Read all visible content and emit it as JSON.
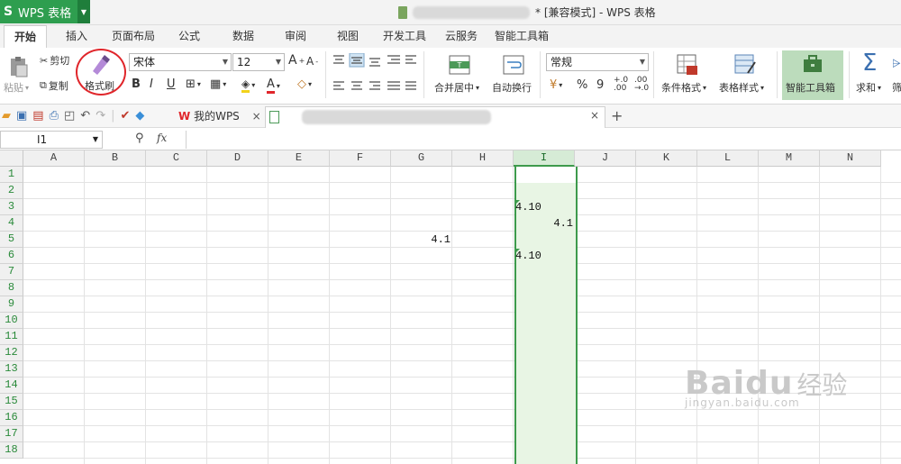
{
  "app": {
    "logo": "S",
    "name": "WPS 表格",
    "window_title": "* [兼容模式] - WPS 表格"
  },
  "tabs": [
    "开始",
    "插入",
    "页面布局",
    "公式",
    "数据",
    "审阅",
    "视图",
    "开发工具",
    "云服务",
    "智能工具箱"
  ],
  "ribbon": {
    "paste": "粘贴",
    "cut": "剪切",
    "copy": "复制",
    "format_painter": "格式刷",
    "font_name": "宋体",
    "font_size": "12",
    "bold": "B",
    "italic": "I",
    "underline": "U",
    "merge_center": "合并居中",
    "wrap_text": "自动换行",
    "number_format": "常规",
    "percent": "%",
    "comma": "9",
    "conditional_format": "条件格式",
    "table_style": "表格样式",
    "smart_toolbox": "智能工具箱",
    "sum": "求和",
    "sum_symbol": "Σ",
    "more": "筛"
  },
  "docbar": {
    "mywps": "我的WPS",
    "close": "×",
    "add": "+"
  },
  "formula": {
    "name_box": "I1",
    "fx": "fx"
  },
  "columns": [
    "A",
    "B",
    "C",
    "D",
    "E",
    "F",
    "G",
    "H",
    "I",
    "J",
    "K",
    "L",
    "M",
    "N"
  ],
  "rows": [
    "1",
    "2",
    "3",
    "4",
    "5",
    "6",
    "7",
    "8",
    "9",
    "10",
    "11",
    "12",
    "13",
    "14",
    "15",
    "16",
    "17",
    "18"
  ],
  "cells": {
    "I3": "4.10",
    "I4": "4.1",
    "G5": "4.1",
    "I6": "4.10"
  },
  "watermark": {
    "brand": "Baidu",
    "cn": "经验",
    "url": "jingyan.baidu.com"
  },
  "colors": {
    "accent": "#2e9e4f",
    "selection": "#e8f5e4",
    "highlight_circle": "#e0262b"
  }
}
